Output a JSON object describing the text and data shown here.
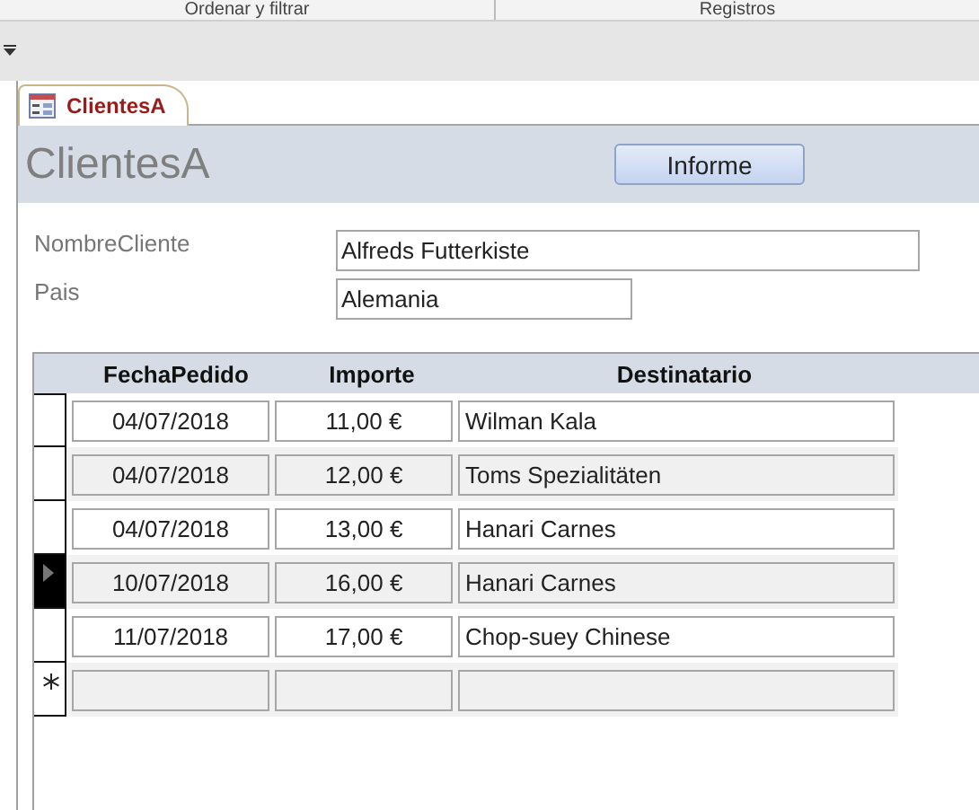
{
  "ribbon": {
    "groups": [
      "Ordenar y filtrar",
      "Registros"
    ]
  },
  "tab": {
    "label": "ClientesA",
    "selected": true
  },
  "form": {
    "title": "ClientesA",
    "button": "Informe",
    "fields": [
      {
        "label": "NombreCliente",
        "value": "Alfreds Futterkiste"
      },
      {
        "label": "Pais",
        "value": "Alemania"
      }
    ]
  },
  "subform": {
    "columns": [
      "FechaPedido",
      "Importe",
      "Destinatario"
    ],
    "rows": [
      {
        "kind": "record",
        "selected": false,
        "cells": [
          "04/07/2018",
          "11,00 €",
          "Wilman Kala"
        ]
      },
      {
        "kind": "record",
        "selected": false,
        "cells": [
          "04/07/2018",
          "12,00 €",
          "Toms Spezialitäten"
        ]
      },
      {
        "kind": "record",
        "selected": false,
        "cells": [
          "04/07/2018",
          "13,00 €",
          "Hanari Carnes"
        ]
      },
      {
        "kind": "record",
        "selected": true,
        "cells": [
          "10/07/2018",
          "16,00 €",
          "Hanari Carnes"
        ]
      },
      {
        "kind": "record",
        "selected": false,
        "cells": [
          "11/07/2018",
          "17,00 €",
          "Chop-suey Chinese"
        ]
      },
      {
        "kind": "new",
        "selected": false,
        "cells": []
      }
    ]
  }
}
